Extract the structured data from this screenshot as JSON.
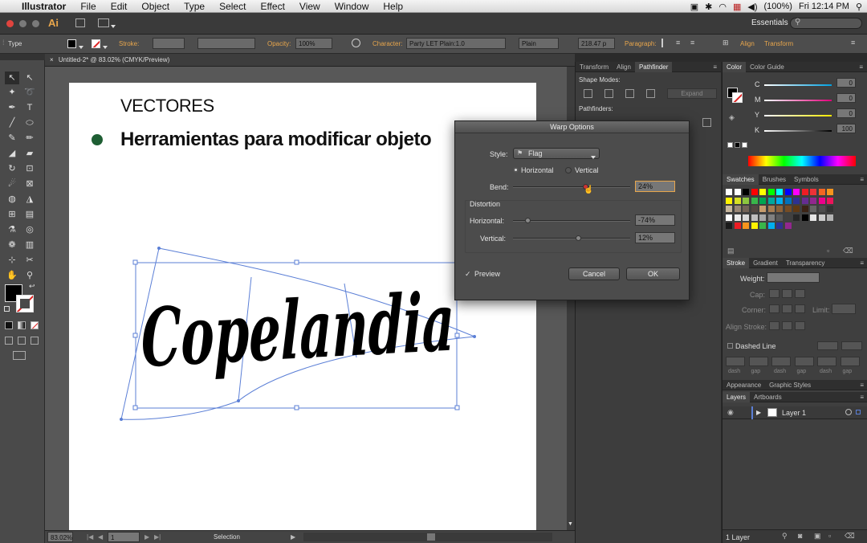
{
  "menubar": {
    "app_name": "Illustrator",
    "items": [
      "File",
      "Edit",
      "Object",
      "Type",
      "Select",
      "Effect",
      "View",
      "Window",
      "Help"
    ],
    "battery": "(100%)",
    "clock": "Fri 12:14 PM"
  },
  "appbar": {
    "logo": "Ai",
    "workspace": "Essentials"
  },
  "control_bar": {
    "selection_label": "Type",
    "stroke_label": "Stroke:",
    "opacity_label": "Opacity:",
    "opacity_value": "100%",
    "character_label": "Character:",
    "font_family": "Party LET Plain:1.0",
    "font_style": "Plain",
    "font_size": "218.47 p",
    "paragraph_label": "Paragraph:",
    "align_label": "Align",
    "transform_label": "Transform"
  },
  "document": {
    "tab_title": "Untitled-2* @ 83.02% (CMYK/Preview)",
    "heading": "VECTORES",
    "bullet_text": "Herramientas para modificar objeto",
    "warped_text": "Copelandia"
  },
  "status_bar": {
    "zoom": "83.02%",
    "page": "1",
    "tool": "Selection"
  },
  "mid_panel": {
    "tabs": [
      "Transform",
      "Align",
      "Pathfinder"
    ],
    "active_tab": "Pathfinder",
    "shape_modes_label": "Shape Modes:",
    "expand_label": "Expand",
    "pathfinders_label": "Pathfinders:"
  },
  "color_panel": {
    "tabs": [
      "Color",
      "Color Guide"
    ],
    "channels": [
      {
        "label": "C",
        "value": "0"
      },
      {
        "label": "M",
        "value": "0"
      },
      {
        "label": "Y",
        "value": "0"
      },
      {
        "label": "K",
        "value": "100"
      }
    ]
  },
  "swatches_panel": {
    "tabs": [
      "Swatches",
      "Brushes",
      "Symbols"
    ]
  },
  "stroke_panel": {
    "tabs": [
      "Stroke",
      "Gradient",
      "Transparency"
    ],
    "weight_label": "Weight:",
    "cap_label": "Cap:",
    "corner_label": "Corner:",
    "limit_label": "Limit:",
    "align_stroke_label": "Align Stroke:",
    "dashed_line_label": "Dashed Line",
    "dash_labels": [
      "dash",
      "gap",
      "dash",
      "gap",
      "dash",
      "gap"
    ]
  },
  "appearance_tabs": [
    "Appearance",
    "Graphic Styles"
  ],
  "layers_panel": {
    "tabs": [
      "Layers",
      "Artboards"
    ],
    "layer_name": "Layer 1",
    "footer": "1 Layer"
  },
  "warp_dialog": {
    "title": "Warp Options",
    "style_label": "Style:",
    "style_value": "Flag",
    "horizontal_label": "Horizontal",
    "vertical_label": "Vertical",
    "orientation": "Horizontal",
    "bend_label": "Bend:",
    "bend_value": "24%",
    "bend_level": 0.62,
    "distortion_label": "Distortion",
    "horizontal_dist_label": "Horizontal:",
    "horizontal_dist_value": "-74%",
    "horizontal_dist_level": 0.13,
    "vertical_dist_label": "Vertical:",
    "vertical_dist_value": "12%",
    "vertical_dist_level": 0.56,
    "preview_label": "Preview",
    "preview_checked": true,
    "cancel_label": "Cancel",
    "ok_label": "OK"
  },
  "colors": {
    "bullet": "#1e5e33",
    "selection": "#5b7fd6",
    "dialog_focus": "#e8a64c"
  }
}
